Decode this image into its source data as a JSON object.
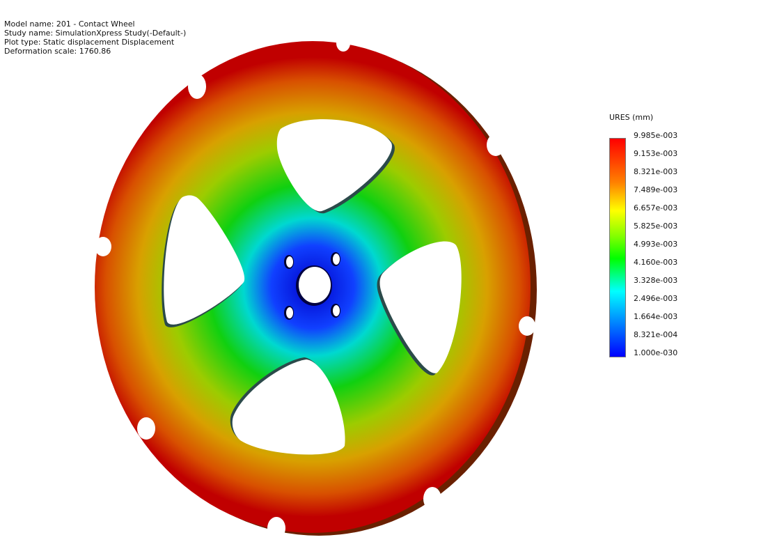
{
  "info": {
    "model_name": "Model name: 201 - Contact Wheel",
    "study_name": "Study name: SimulationXpress Study(-Default-)",
    "plot_type": "Plot type: Static displacement Displacement",
    "deformation_scale": "Deformation scale: 1760.86"
  },
  "legend": {
    "title": "URES (mm)",
    "labels": [
      "9.985e-003",
      "9.153e-003",
      "8.321e-003",
      "7.489e-003",
      "6.657e-003",
      "5.825e-003",
      "4.993e-003",
      "4.160e-003",
      "3.328e-003",
      "2.496e-003",
      "1.664e-003",
      "8.321e-004",
      "1.000e-030"
    ]
  },
  "colors": {
    "max": "#ff0000",
    "high": "#ff8000",
    "mid_high": "#ffff00",
    "mid": "#00ff00",
    "mid_low": "#00ffff",
    "low": "#0080ff",
    "min": "#0000ff"
  }
}
